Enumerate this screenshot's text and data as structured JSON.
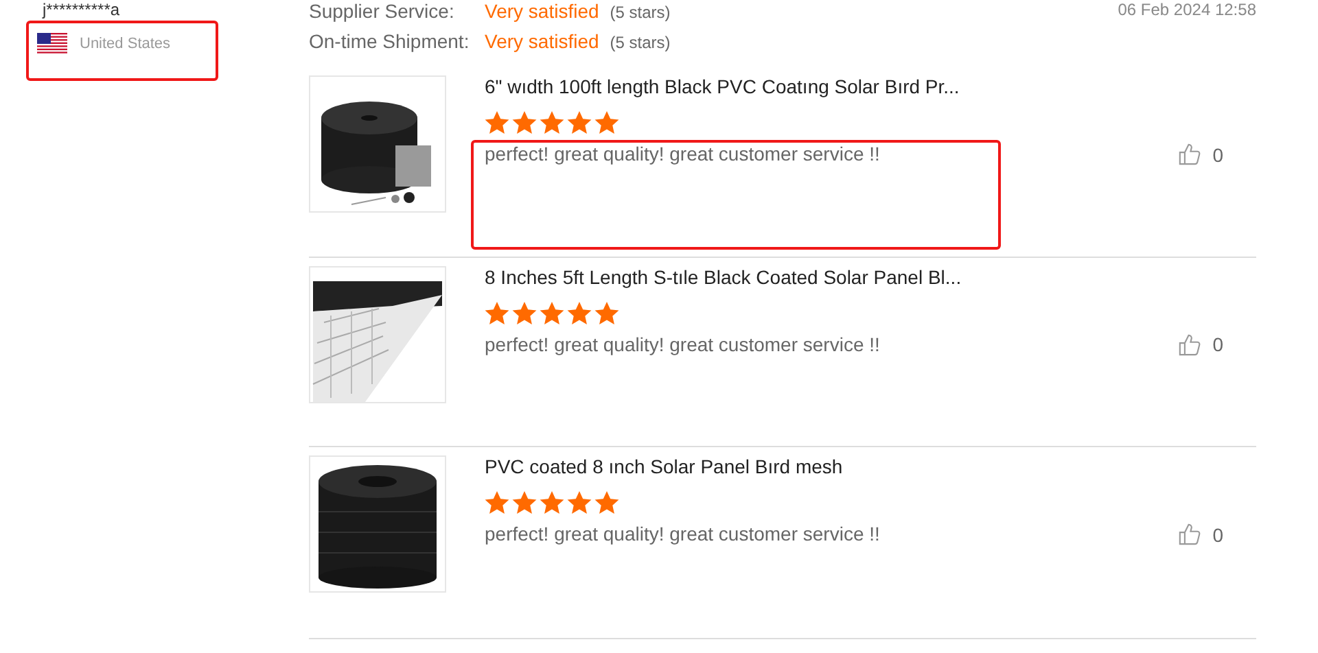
{
  "reviewer": {
    "name": "j**********a",
    "country": "United States",
    "highlighted": true
  },
  "ratings": [
    {
      "label": "Supplier Service:",
      "value": "Very satisfied",
      "stars_text": "(5 stars)"
    },
    {
      "label": "On-time Shipment:",
      "value": "Very satisfied",
      "stars_text": "(5 stars)"
    }
  ],
  "date": "06 Feb 2024 12:58",
  "reviews": [
    {
      "kind": "roll",
      "title": "6\" wıdth 100ft length Black PVC Coatıng Solar Bırd Pr...",
      "stars": 5,
      "comment": "perfect! great quality! great customer service !!",
      "highlighted": true,
      "likes": "0"
    },
    {
      "kind": "strip",
      "title": "8 Inches 5ft Length S-tıle Black Coated Solar Panel Bl...",
      "stars": 5,
      "comment": "perfect! great quality! great customer service !!",
      "highlighted": false,
      "likes": "0"
    },
    {
      "kind": "coil",
      "title": "PVC coated 8 ınch Solar Panel Bırd mesh",
      "stars": 5,
      "comment": "perfect! great quality! great customer service !!",
      "highlighted": false,
      "likes": "0"
    }
  ]
}
